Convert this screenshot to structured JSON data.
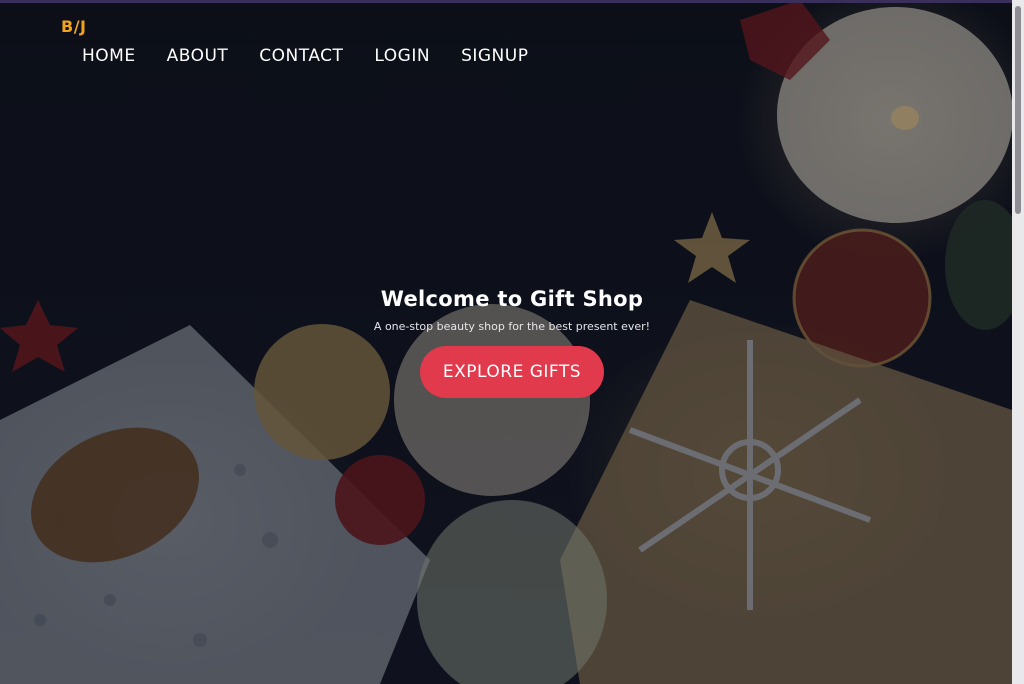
{
  "brand": {
    "logo_text": "B/J"
  },
  "nav": {
    "items": [
      {
        "label": "HOME"
      },
      {
        "label": "ABOUT"
      },
      {
        "label": "CONTACT"
      },
      {
        "label": "LOGIN"
      },
      {
        "label": "SIGNUP"
      }
    ]
  },
  "hero": {
    "title": "Welcome to Gift Shop",
    "subtitle": "A one-stop beauty shop for the best present ever!",
    "cta_label": "EXPLORE GIFTS"
  },
  "colors": {
    "brand_accent": "#f0a21b",
    "cta_background": "#e23a4d",
    "nav_text": "#ffffff",
    "background_dark": "#0f121d"
  }
}
